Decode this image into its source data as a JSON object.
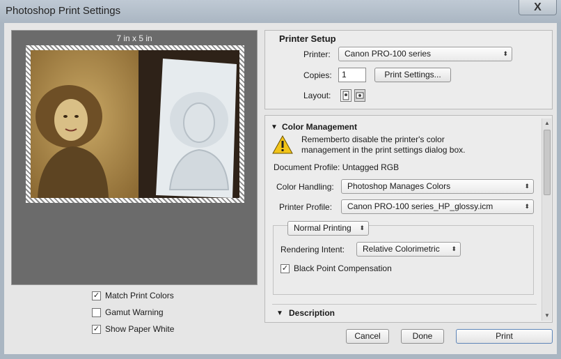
{
  "window": {
    "title": "Photoshop Print Settings",
    "close_glyph": "X"
  },
  "preview": {
    "size_label": "7 in x 5 in"
  },
  "preview_options": [
    {
      "label": "Match Print Colors",
      "checked": true
    },
    {
      "label": "Gamut Warning",
      "checked": false
    },
    {
      "label": "Show Paper White",
      "checked": true
    }
  ],
  "printer_setup": {
    "title": "Printer Setup",
    "printer_label": "Printer:",
    "printer_value": "Canon PRO-100 series",
    "copies_label": "Copies:",
    "copies_value": "1",
    "print_settings_button": "Print Settings...",
    "layout_label": "Layout:",
    "layout_icons": [
      "portrait-layout-icon",
      "landscape-layout-icon"
    ]
  },
  "color_management": {
    "title": "Color Management",
    "warning_line1": "Rememberto disable the printer's color",
    "warning_line2": "management in the print settings dialog box.",
    "document_profile": "Document Profile: Untagged RGB",
    "color_handling_label": "Color Handling:",
    "color_handling_value": "Photoshop Manages Colors",
    "printer_profile_label": "Printer Profile:",
    "printer_profile_value": "Canon PRO-100 series_HP_glossy.icm",
    "printing_mode": "Normal Printing",
    "rendering_intent_label": "Rendering Intent:",
    "rendering_intent_value": "Relative Colorimetric",
    "black_point_label": "Black Point Compensation",
    "black_point_checked": true
  },
  "description": {
    "title": "Description"
  },
  "footer": {
    "cancel": "Cancel",
    "done": "Done",
    "print": "Print"
  },
  "colors": {
    "warning": "#f2c418",
    "preview_bg": "#6b6b6b",
    "sepia": "#b9934f"
  },
  "check_glyph": "✓"
}
